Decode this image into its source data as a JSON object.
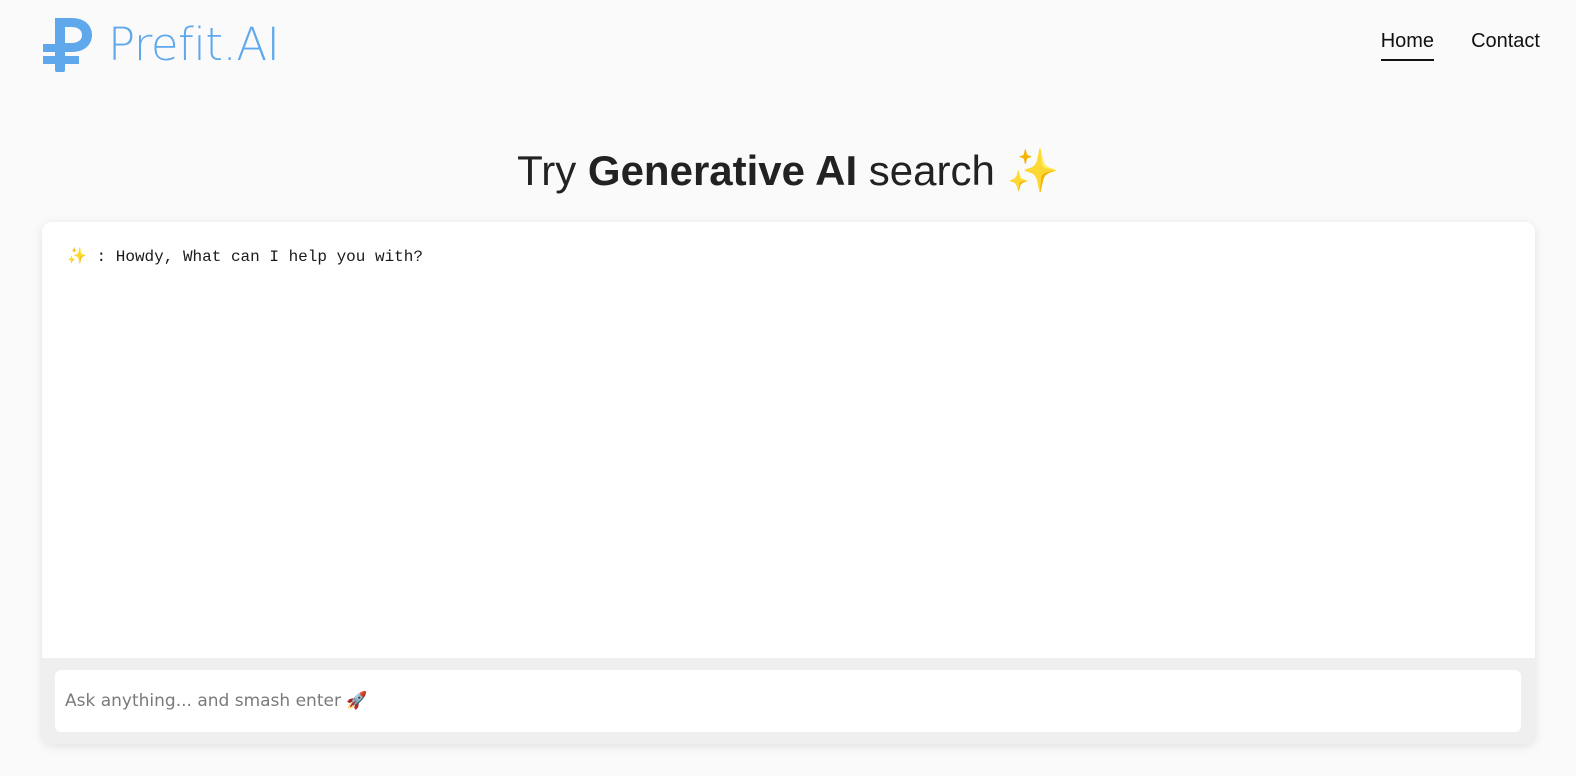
{
  "brand": {
    "name": "Prefit.AI",
    "logo_icon": "ruble-sign-icon",
    "color": "#5fa8ec"
  },
  "nav": {
    "items": [
      {
        "label": "Home",
        "active": true
      },
      {
        "label": "Contact",
        "active": false
      }
    ]
  },
  "hero": {
    "prefix": "Try ",
    "emphasis": "Generative AI",
    "suffix": " search ",
    "emoji": "✨"
  },
  "chat": {
    "messages": [
      {
        "sender_icon": "✨",
        "separator": " : ",
        "text": "Howdy, What can I help you with?"
      }
    ]
  },
  "input": {
    "placeholder": "Ask anything... and smash enter 🚀",
    "value": ""
  }
}
